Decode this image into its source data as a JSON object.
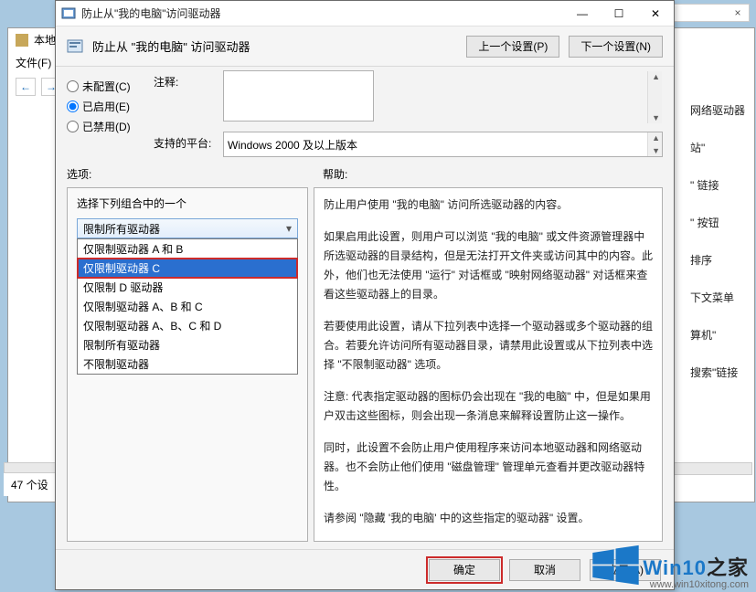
{
  "bg": {
    "console_title": "本地",
    "file_menu": "文件(F)",
    "nav_back": "←",
    "nav_fwd": "→",
    "count": "47 个设",
    "side_hints": [
      "网络驱动器",
      "站\"",
      "\" 链接",
      "\" 按钮",
      "排序",
      "下文菜单",
      "算机\"",
      "搜索\"链接"
    ]
  },
  "window": {
    "title": "防止从\"我的电脑\"访问驱动器",
    "minimize": "—",
    "maximize": "☐",
    "close": "✕"
  },
  "header": {
    "policy_title": "防止从 \"我的电脑\" 访问驱动器",
    "prev": "上一个设置(P)",
    "next": "下一个设置(N)"
  },
  "radios": {
    "not_configured": "未配置(C)",
    "enabled": "已启用(E)",
    "disabled": "已禁用(D)",
    "selected": "enabled"
  },
  "labels": {
    "comment": "注释:",
    "platform": "支持的平台:",
    "options": "选项:",
    "help": "帮助:",
    "group": "选择下列组合中的一个"
  },
  "platform_value": "Windows 2000 及以上版本",
  "combo": {
    "value": "限制所有驱动器",
    "items": [
      "仅限制驱动器 A 和 B",
      "仅限制驱动器 C",
      "仅限制 D 驱动器",
      "仅限制驱动器 A、B 和 C",
      "仅限制驱动器 A、B、C 和 D",
      "限制所有驱动器",
      "不限制驱动器"
    ],
    "selected_index": 1
  },
  "help_text": {
    "p1": "防止用户使用 \"我的电脑\" 访问所选驱动器的内容。",
    "p2": "如果启用此设置，则用户可以浏览 \"我的电脑\" 或文件资源管理器中所选驱动器的目录结构，但是无法打开文件夹或访问其中的内容。此外，他们也无法使用 \"运行\" 对话框或 \"映射网络驱动器\" 对话框来查看这些驱动器上的目录。",
    "p3": "若要使用此设置，请从下拉列表中选择一个驱动器或多个驱动器的组合。若要允许访问所有驱动器目录，请禁用此设置或从下拉列表中选择 \"不限制驱动器\" 选项。",
    "p4": "注意: 代表指定驱动器的图标仍会出现在 \"我的电脑\" 中，但是如果用户双击这些图标，则会出现一条消息来解释设置防止这一操作。",
    "p5": "  同时，此设置不会防止用户使用程序来访问本地驱动器和网络驱动器。也不会防止他们使用 \"磁盘管理\" 管理单元查看并更改驱动器特性。",
    "p6": "请参阅 \"隐藏 '我的电脑' 中的这些指定的驱动器\" 设置。"
  },
  "footer": {
    "ok": "确定",
    "cancel": "取消",
    "apply": "应用(A)"
  },
  "watermark": {
    "brand1": "Win10",
    "brand2": "之家",
    "url": "www.win10xitong.com"
  }
}
